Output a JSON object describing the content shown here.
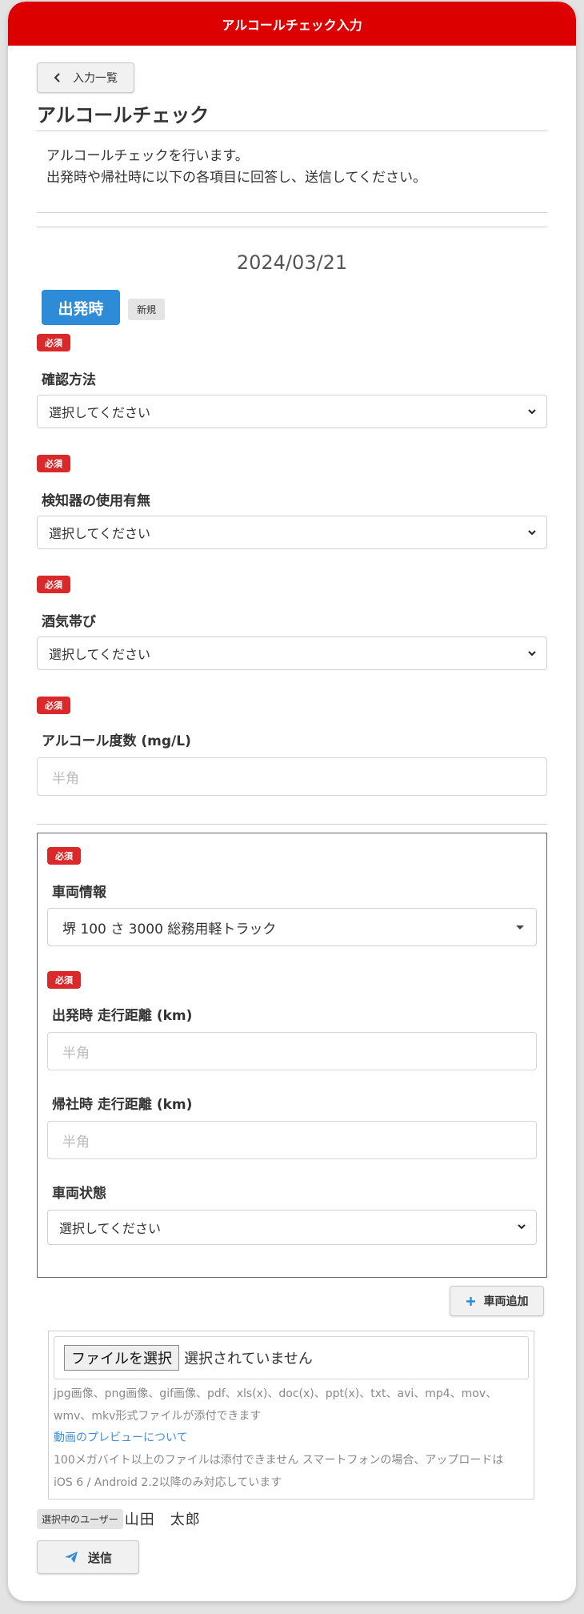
{
  "header": {
    "title": "アルコールチェック入力"
  },
  "nav": {
    "back_label": "入力一覧"
  },
  "page": {
    "title": "アルコールチェック",
    "intro_line1": "アルコールチェックを行います。",
    "intro_line2": "出発時や帰社時に以下の各項目に回答し、送信してください。"
  },
  "date": "2024/03/21",
  "timing_badge": "出発時",
  "new_badge": "新規",
  "required_label": "必須",
  "fields": {
    "method": {
      "label": "確認方法",
      "value": "選択してください"
    },
    "detector": {
      "label": "検知器の使用有無",
      "value": "選択してください"
    },
    "alcohol": {
      "label": "酒気帯び",
      "value": "選択してください"
    },
    "concentration": {
      "label": "アルコール度数 (mg/L)",
      "placeholder": "半角"
    }
  },
  "vehicle": {
    "label": "車両情報",
    "value": "堺 100 さ 3000 総務用軽トラック",
    "start_distance": {
      "label": "出発時 走行距離 (km)",
      "placeholder": "半角"
    },
    "return_distance": {
      "label": "帰社時 走行距離 (km)",
      "placeholder": "半角"
    },
    "condition": {
      "label": "車両状態",
      "value": "選択してください"
    },
    "add_button": "車両追加"
  },
  "upload": {
    "button": "ファイルを選択",
    "status": "選択されていません",
    "note1": "jpg画像、png画像、gif画像、pdf、xls(x)、doc(x)、ppt(x)、txt、avi、mp4、mov、",
    "note2": "wmv、mkv形式ファイルが添付できます",
    "preview_link": "動画のプレビューについて",
    "note3": "100メガバイト以上のファイルは添付できません スマートフォンの場合、アップロードは",
    "note4": "iOS 6 / Android 2.2以降のみ対応しています"
  },
  "user": {
    "chip": "選択中のユーザー",
    "name": "山田　太郎"
  },
  "submit": {
    "label": "送信"
  },
  "colors": {
    "header": "#dc0000",
    "required": "#d9292b",
    "timing": "#2d8bd8",
    "link": "#3d8fd6"
  }
}
